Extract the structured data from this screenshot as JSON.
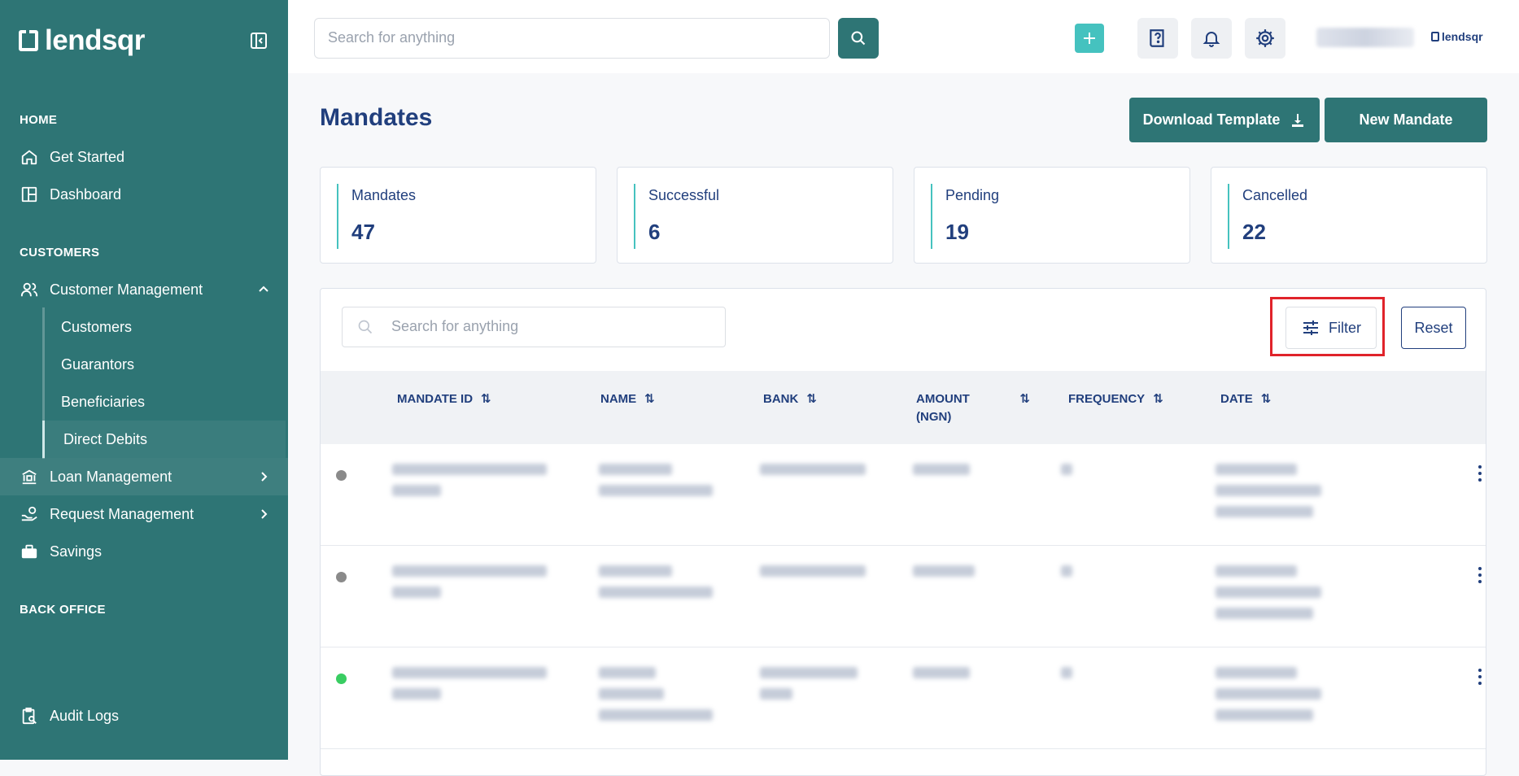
{
  "brand": {
    "name": "lendsqr",
    "mini_name": "lendsqr"
  },
  "sidebar": {
    "sections": {
      "home": "HOME",
      "customers": "CUSTOMERS",
      "back_office": "BACK OFFICE"
    },
    "items": {
      "get_started": "Get Started",
      "dashboard": "Dashboard",
      "customer_management": "Customer Management",
      "customers": "Customers",
      "guarantors": "Guarantors",
      "beneficiaries": "Beneficiaries",
      "direct_debits": "Direct Debits",
      "loan_management": "Loan Management",
      "request_management": "Request Management",
      "savings": "Savings",
      "audit_logs": "Audit Logs"
    }
  },
  "topbar": {
    "search_placeholder": "Search for anything"
  },
  "page": {
    "title": "Mandates",
    "download_template": "Download Template",
    "new_mandate": "New Mandate"
  },
  "stats": [
    {
      "label": "Mandates",
      "value": "47"
    },
    {
      "label": "Successful",
      "value": "6"
    },
    {
      "label": "Pending",
      "value": "19"
    },
    {
      "label": "Cancelled",
      "value": "22"
    }
  ],
  "table": {
    "search_placeholder": "Search for anything",
    "filter_label": "Filter",
    "reset_label": "Reset",
    "columns": {
      "mandate_id": "MANDATE ID",
      "name": "NAME",
      "bank": "BANK",
      "amount": "AMOUNT",
      "amount_unit": "(NGN)",
      "frequency": "FREQUENCY",
      "date": "DATE"
    },
    "row_status_colors": [
      "#8a8a8a",
      "#8a8a8a",
      "#39cd62"
    ]
  },
  "colors": {
    "sidebar_bg": "#2e7575",
    "accent": "#45c2bf",
    "primary_text": "#213f7d",
    "highlight": "#e0232a"
  }
}
